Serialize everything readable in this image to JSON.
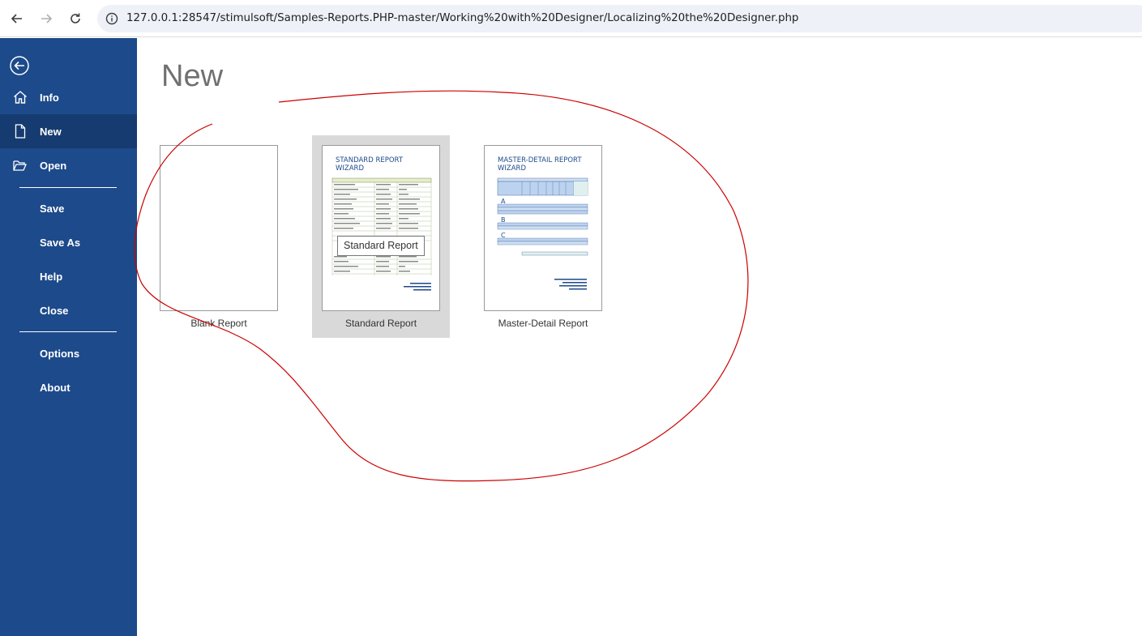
{
  "browser": {
    "url": "127.0.0.1:28547/stimulsoft/Samples-Reports.PHP-master/Working%20with%20Designer/Localizing%20the%20Designer.php"
  },
  "sidebar": {
    "items": [
      {
        "label": "Info"
      },
      {
        "label": "New"
      },
      {
        "label": "Open"
      },
      {
        "label": "Save"
      },
      {
        "label": "Save As"
      },
      {
        "label": "Help"
      },
      {
        "label": "Close"
      },
      {
        "label": "Options"
      },
      {
        "label": "About"
      }
    ]
  },
  "main": {
    "title": "New",
    "templates": [
      {
        "label": "Blank Report"
      },
      {
        "label": "Standard Report",
        "thumb_title_1": "STANDARD REPORT",
        "thumb_title_2": "WIZARD"
      },
      {
        "label": "Master-Detail Report",
        "thumb_title_1": "MASTER-DETAIL REPORT",
        "thumb_title_2": "WIZARD"
      }
    ],
    "tooltip": "Standard Report"
  },
  "colors": {
    "sidebar": "#1d4a8b",
    "sidebar_active": "#163b70",
    "selected_card": "#d9d9d9",
    "annotation": "#cc0000"
  }
}
